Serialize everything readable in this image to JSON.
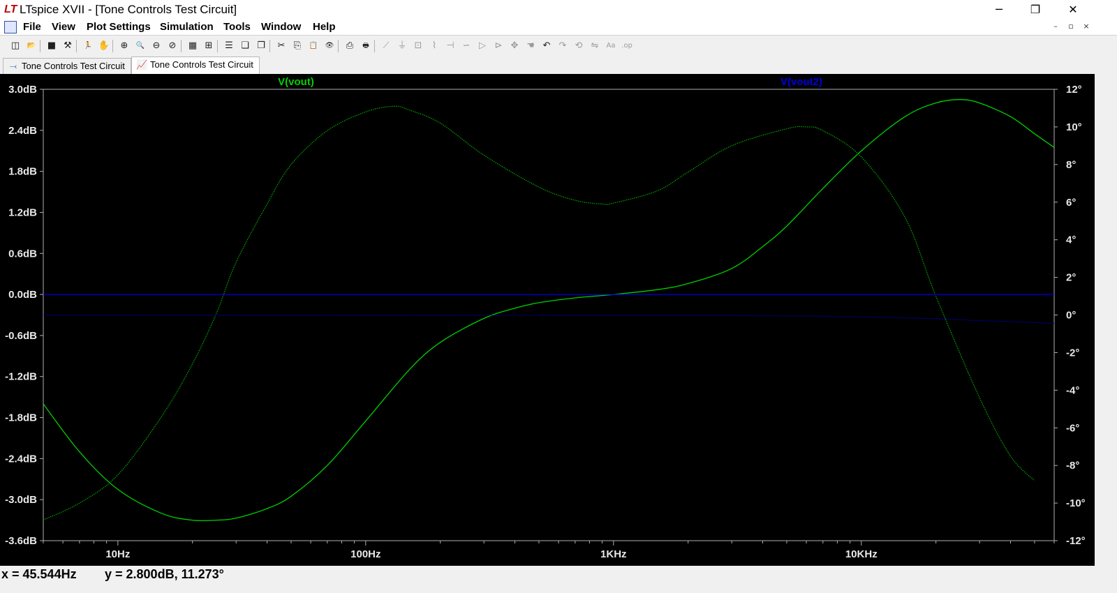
{
  "window": {
    "app_logo": "LT",
    "title": "LTspice XVII - [Tone Controls Test Circuit]",
    "minimize": "─",
    "maximize": "❐",
    "close": "✕"
  },
  "menu": {
    "items": [
      "File",
      "View",
      "Plot Settings",
      "Simulation",
      "Tools",
      "Window",
      "Help"
    ],
    "mdi": [
      "–",
      "▫",
      "×"
    ]
  },
  "toolbar": {
    "buttons": [
      {
        "icon": "new-schematic-icon",
        "glyph": "◫",
        "enabled": true
      },
      {
        "icon": "open-icon",
        "glyph": "📂",
        "enabled": true
      },
      {
        "icon": "save-icon",
        "glyph": "■",
        "enabled": true
      },
      {
        "icon": "control-panel-icon",
        "glyph": "⚒",
        "enabled": true
      },
      {
        "icon": "run-icon",
        "glyph": "🏃",
        "enabled": true
      },
      {
        "icon": "halt-icon",
        "glyph": "✋",
        "enabled": false
      },
      {
        "icon": "zoom-in-icon",
        "glyph": "⊕",
        "enabled": true
      },
      {
        "icon": "zoom-pan-icon",
        "glyph": "🔍",
        "enabled": true
      },
      {
        "icon": "zoom-out-icon",
        "glyph": "⊖",
        "enabled": true
      },
      {
        "icon": "zoom-fit-icon",
        "glyph": "⊘",
        "enabled": true
      },
      {
        "icon": "autorange-icon",
        "glyph": "▦",
        "enabled": true
      },
      {
        "icon": "grid-icon",
        "glyph": "⊞",
        "enabled": true
      },
      {
        "icon": "tile-horizontal-icon",
        "glyph": "☰",
        "enabled": true
      },
      {
        "icon": "cascade-icon",
        "glyph": "❏",
        "enabled": true
      },
      {
        "icon": "tile-vertical-icon",
        "glyph": "❐",
        "enabled": true
      },
      {
        "icon": "cut-icon",
        "glyph": "✂",
        "enabled": true
      },
      {
        "icon": "copy-icon",
        "glyph": "⎘",
        "enabled": true
      },
      {
        "icon": "paste-icon",
        "glyph": "📋",
        "enabled": false
      },
      {
        "icon": "find-icon",
        "glyph": "👁",
        "enabled": true
      },
      {
        "icon": "print-preview-icon",
        "glyph": "⎙",
        "enabled": true
      },
      {
        "icon": "print-icon",
        "glyph": "🖶",
        "enabled": true
      },
      {
        "icon": "wire-icon",
        "glyph": "⟋",
        "enabled": false
      },
      {
        "icon": "ground-icon",
        "glyph": "⏚",
        "enabled": false
      },
      {
        "icon": "label-net-icon",
        "glyph": "⊡",
        "enabled": false
      },
      {
        "icon": "resistor-icon",
        "glyph": "⌇",
        "enabled": false
      },
      {
        "icon": "capacitor-icon",
        "glyph": "⊣",
        "enabled": false
      },
      {
        "icon": "inductor-icon",
        "glyph": "∽",
        "enabled": false
      },
      {
        "icon": "diode-icon",
        "glyph": "▷",
        "enabled": false
      },
      {
        "icon": "component-icon",
        "glyph": "⊳",
        "enabled": false
      },
      {
        "icon": "move-icon",
        "glyph": "✥",
        "enabled": false
      },
      {
        "icon": "drag-icon",
        "glyph": "☚",
        "enabled": false
      },
      {
        "icon": "undo-icon",
        "glyph": "↶",
        "enabled": true
      },
      {
        "icon": "redo-icon",
        "glyph": "↷",
        "enabled": false
      },
      {
        "icon": "rotate-icon",
        "glyph": "⟲",
        "enabled": false
      },
      {
        "icon": "mirror-icon",
        "glyph": "⇋",
        "enabled": false
      },
      {
        "icon": "text-icon",
        "glyph": "Aa",
        "enabled": false
      },
      {
        "icon": "spice-directive-icon",
        "glyph": ".op",
        "enabled": false
      }
    ]
  },
  "tabs": [
    {
      "label": "Tone Controls Test Circuit",
      "icon": "schematic-icon",
      "glyph": "⤙",
      "active": false
    },
    {
      "label": "Tone Controls Test Circuit",
      "icon": "waveform-icon",
      "glyph": "📈",
      "active": true
    }
  ],
  "plot": {
    "background": "#000000",
    "trace_labels": [
      {
        "name": "V(vout)",
        "color": "#00d000"
      },
      {
        "name": "V(vout2)",
        "color": "#0000e0"
      }
    ]
  },
  "chart_data": {
    "type": "line",
    "title": "",
    "xlabel": "",
    "ylabel": "",
    "x_scale": "log",
    "xlim": [
      5,
      60000
    ],
    "x_ticks": [
      10,
      100,
      1000,
      10000
    ],
    "x_tick_labels": [
      "10Hz",
      "100Hz",
      "1KHz",
      "10KHz"
    ],
    "ylim_left": [
      -3.6,
      3.0
    ],
    "y_left_ticks": [
      3.0,
      2.4,
      1.8,
      1.2,
      0.6,
      0.0,
      -0.6,
      -1.2,
      -1.8,
      -2.4,
      -3.0,
      -3.6
    ],
    "y_left_tick_labels": [
      "3.0dB",
      "2.4dB",
      "1.8dB",
      "1.2dB",
      "0.6dB",
      "0.0dB",
      "-0.6dB",
      "-1.2dB",
      "-1.8dB",
      "-2.4dB",
      "-3.0dB",
      "-3.6dB"
    ],
    "ylim_right": [
      -12,
      12
    ],
    "y_right_ticks": [
      12,
      10,
      8,
      6,
      4,
      2,
      0,
      -2,
      -4,
      -6,
      -8,
      -10,
      -12
    ],
    "y_right_tick_labels": [
      "12°",
      "10°",
      "8°",
      "6°",
      "4°",
      "2°",
      "0°",
      "-2°",
      "-4°",
      "-6°",
      "-8°",
      "-10°",
      "-12°"
    ],
    "grid": false,
    "series": [
      {
        "name": "V(vout)",
        "quantity": "magnitude",
        "axis": "left",
        "color": "#00d000",
        "style": "solid",
        "x": [
          5,
          7,
          10,
          15,
          20,
          25,
          30,
          40,
          50,
          70,
          100,
          150,
          200,
          300,
          400,
          500,
          700,
          1000,
          1500,
          2000,
          3000,
          4000,
          5000,
          7000,
          10000,
          15000,
          20000,
          25000,
          30000,
          40000,
          50000,
          60000
        ],
        "y": [
          -1.6,
          -2.3,
          -2.85,
          -3.2,
          -3.3,
          -3.3,
          -3.27,
          -3.13,
          -2.95,
          -2.5,
          -1.85,
          -1.1,
          -0.7,
          -0.35,
          -0.2,
          -0.12,
          -0.05,
          0.0,
          0.07,
          0.16,
          0.38,
          0.7,
          1.0,
          1.55,
          2.1,
          2.6,
          2.8,
          2.85,
          2.8,
          2.6,
          2.35,
          2.15
        ]
      },
      {
        "name": "V(vout)",
        "quantity": "phase",
        "axis": "right",
        "color": "#00d000",
        "style": "dotted",
        "x": [
          5,
          7,
          10,
          15,
          20,
          25,
          30,
          40,
          50,
          70,
          100,
          130,
          150,
          200,
          300,
          500,
          700,
          900,
          1000,
          1500,
          2000,
          3000,
          5000,
          6000,
          7000,
          10000,
          15000,
          20000,
          30000,
          40000,
          50000
        ],
        "y": [
          -10.9,
          -10.0,
          -8.5,
          -5.4,
          -2.6,
          0.1,
          2.8,
          5.9,
          8.0,
          9.8,
          10.8,
          11.1,
          10.9,
          10.2,
          8.5,
          6.8,
          6.1,
          5.9,
          5.95,
          6.6,
          7.6,
          9.0,
          9.9,
          10.0,
          9.8,
          8.4,
          5.2,
          1.0,
          -4.4,
          -7.5,
          -8.8
        ]
      },
      {
        "name": "V(vout2)",
        "quantity": "magnitude",
        "axis": "left",
        "color": "#0000e0",
        "style": "solid",
        "x": [
          5,
          60000
        ],
        "y": [
          0.0,
          0.0
        ]
      },
      {
        "name": "V(vout2)",
        "quantity": "phase",
        "axis": "right",
        "color": "#0000e0",
        "style": "dotted",
        "x": [
          5,
          1000,
          5000,
          10000,
          20000,
          30000,
          40000,
          60000
        ],
        "y": [
          -0.01,
          -0.02,
          -0.05,
          -0.1,
          -0.2,
          -0.3,
          -0.35,
          -0.45
        ]
      }
    ]
  },
  "status": {
    "x_readout": "x = 45.544Hz",
    "y_readout": "y = 2.800dB, 11.273°"
  }
}
